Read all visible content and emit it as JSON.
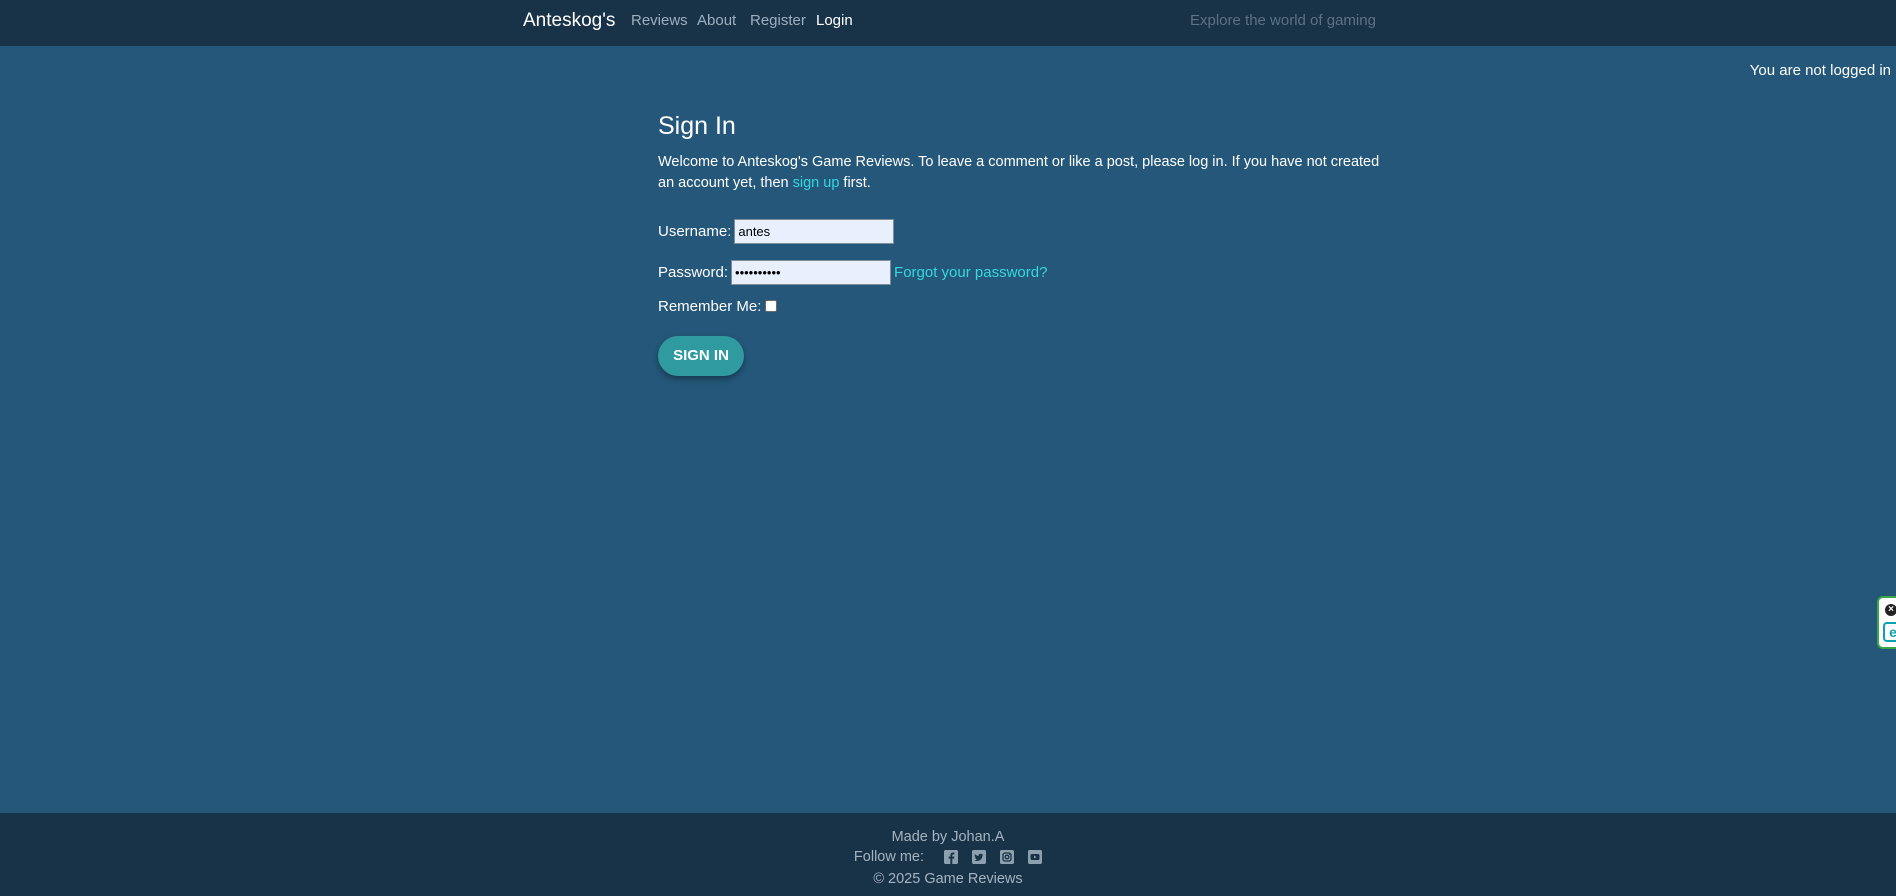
{
  "nav": {
    "brand": "Anteskog's",
    "links": [
      {
        "label": "Reviews"
      },
      {
        "label": "About"
      },
      {
        "label": "Register"
      },
      {
        "label": "Login"
      }
    ],
    "search_placeholder": "Explore the world of gaming"
  },
  "status": {
    "login_text": "You are not logged in"
  },
  "main": {
    "title": "Sign In",
    "intro_before": "Welcome to Anteskog's Game Reviews. To leave a comment or like a post, please log in. If you have not created an account yet, then",
    "intro_link": "sign up",
    "intro_after": "first."
  },
  "form": {
    "username_label": "Username:",
    "username_value": "antes",
    "password_label": "Password:",
    "password_value": "••••••••••",
    "forgot_link": "Forgot your password?",
    "remember_label": "Remember Me:",
    "remember_checked": false,
    "submit_label": "SIGN IN"
  },
  "footer": {
    "made_by": "Made by Johan.A",
    "follow_label": "Follow me:",
    "social_icons": [
      "facebook-icon",
      "twitter-icon",
      "instagram-icon",
      "youtube-icon"
    ],
    "copyright": "© 2025 Game Reviews"
  },
  "colors": {
    "background": "#245779",
    "header_footer": "#183247",
    "link": "#34d8e0",
    "button": "#2f9aa0"
  }
}
